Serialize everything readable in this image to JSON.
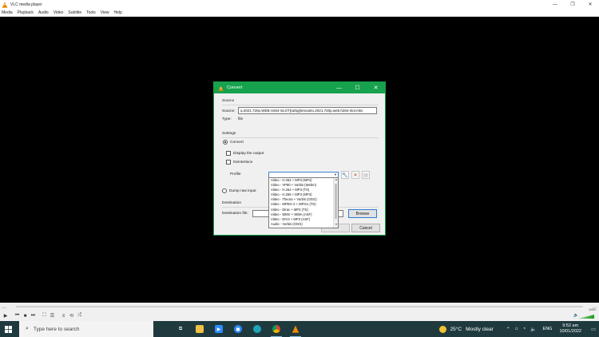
{
  "app": {
    "title": "VLC media player",
    "menu": [
      "Media",
      "Playback",
      "Audio",
      "Video",
      "Subtitle",
      "Tools",
      "View",
      "Help"
    ],
    "window_controls": {
      "minimize": "—",
      "maximize": "❐",
      "close": "✕"
    }
  },
  "player": {
    "time_elapsed": "--:--",
    "time_total": "--:--",
    "volume": "100%"
  },
  "dialog": {
    "title": "Convert",
    "controls": {
      "minimize": "—",
      "maximize": "☐",
      "close": "✕"
    },
    "source_section": "Source",
    "source_label": "Source:",
    "source_value": "a.2021.720p.WEB.H264-SLOT[rarbg]\\encanto.2021.720p.web.h264-slot.mkv",
    "type_label": "Type:",
    "type_value": "file",
    "settings_section": "Settings",
    "convert_label": "Convert",
    "display_output_label": "Display the output",
    "deinterlace_label": "Deinterlace",
    "profile_label": "Profile",
    "dump_raw_label": "Dump raw input",
    "destination_section": "Destination",
    "destination_file_label": "Destination file:",
    "browse_label": "Browse",
    "cancel_label": "Cancel",
    "profile_options": [
      "Video - H.264 + MP3 (MP4)",
      "Video - VP80 + Vorbis (Webm)",
      "Video - H.264 + MP3 (TS)",
      "Video - H.265 + MP3 (MP4)",
      "Video - Theora + Vorbis (OGG)",
      "Video - MPEG-2 + MPGA (TS)",
      "Video - Dirac + MP3 (TS)",
      "Video - WMV + WMA (ASF)",
      "Video - DIV3 + MP3 (ASF)",
      "Audio - Vorbis (OGG)"
    ]
  },
  "taskbar": {
    "search_placeholder": "Type here to search",
    "weather_temp": "25°C",
    "weather_desc": "Mostly clear",
    "language": "ENG",
    "time": "9:52 am",
    "date": "10/01/2022"
  }
}
